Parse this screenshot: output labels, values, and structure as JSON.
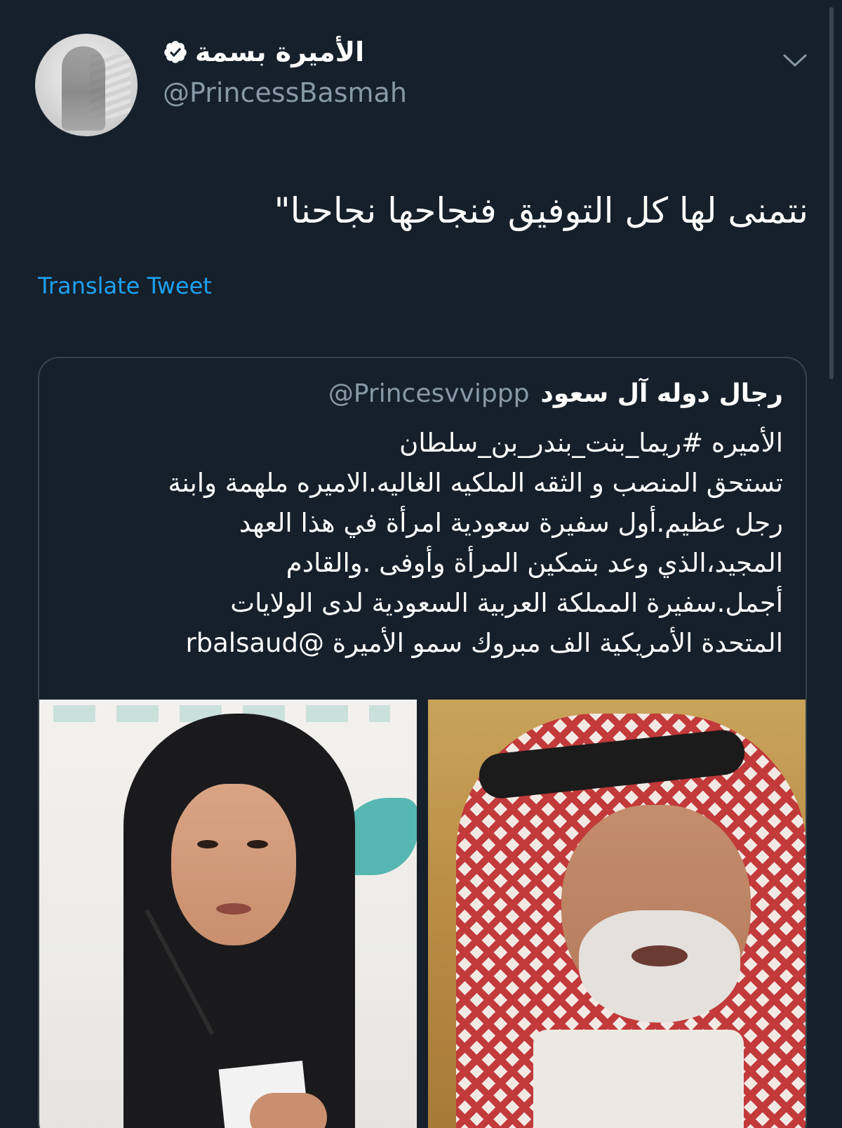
{
  "tweet": {
    "author": {
      "display_name": "الأميرة بسمة",
      "handle": "@PrincessBasmah",
      "verified": true
    },
    "text": "نتمنى لها كل التوفيق فنجاحها نجاحنا\"",
    "translate_label": "Translate Tweet"
  },
  "quoted_tweet": {
    "author": {
      "display_name": "رجال دوله آل سعود",
      "handle": "@Princesvvippp"
    },
    "lines": [
      "الأميره #ريما_بنت_بندر_بن_سلطان",
      "تستحق المنصب و الثقه الملكيه الغاليه.الاميره ملهمة وابنة",
      "رجل عظيم.أول سفيرة سعودية امرأة في هذا العهد",
      "المجيد،الذي وعد بتمكين المرأة وأوفى .والقادم",
      "أجمل.سفيرة المملكة العربية السعودية لدى الولايات",
      "المتحدة الأمريكية الف مبروك سمو الأميرة @rbalsaud"
    ]
  },
  "colors": {
    "background": "#15202b",
    "link": "#1da1f2",
    "muted_text": "#8899a6",
    "border": "#38444d"
  },
  "icons": {
    "verified": "verified-badge-icon",
    "menu": "chevron-down-icon"
  }
}
